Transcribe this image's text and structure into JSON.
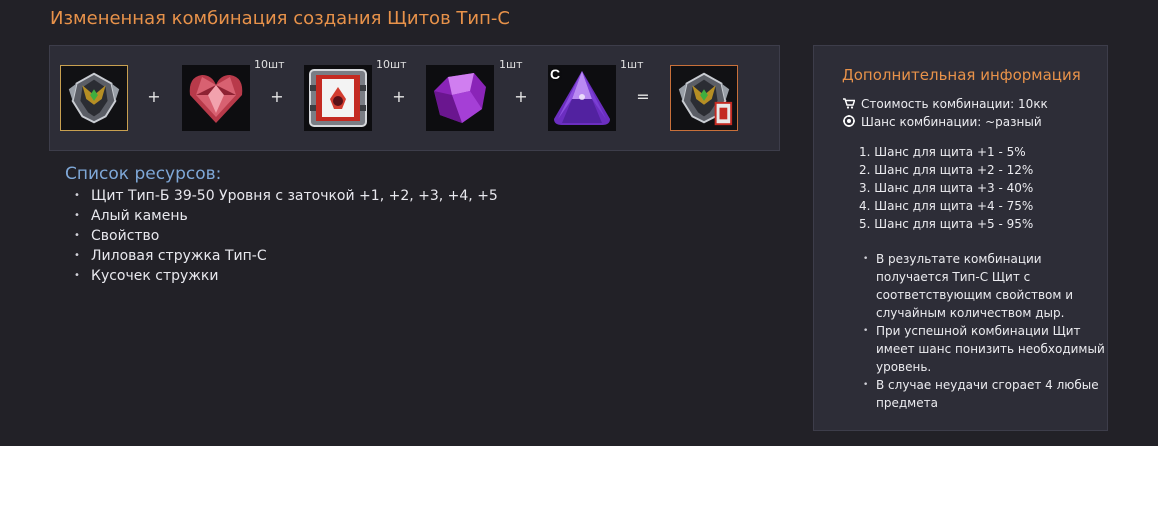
{
  "title": "Измененная комбинация создания Щитов Тип-С",
  "combination": {
    "items": [
      {
        "name": "Щит Тип-Б",
        "count": "",
        "label": ""
      },
      {
        "name": "Алый камень",
        "count": "10шт",
        "label": ""
      },
      {
        "name": "Свойство",
        "count": "10шт",
        "label": ""
      },
      {
        "name": "Лиловая стружка Тип-С",
        "count": "1шт",
        "label": ""
      },
      {
        "name": "Кусочек стружки",
        "count": "1шт",
        "label": "C"
      }
    ],
    "operators": [
      "+",
      "+",
      "+",
      "+",
      "="
    ],
    "result": {
      "name": "Щит Тип-С"
    }
  },
  "resources": {
    "heading": "Список ресурсов:",
    "items": [
      "Щит Тип-Б 39-50 Уровня с заточкой +1, +2, +3, +4, +5",
      "Алый камень",
      "Свойство",
      "Лиловая стружка Тип-С",
      "Кусочек стружки"
    ]
  },
  "info": {
    "heading": "Дополнительная информация",
    "cost": "Стоимость комбинации: 10кк",
    "chance": "Шанс комбинации: ~разный",
    "chances": [
      "1. Шанс для щита +1 - 5%",
      "2. Шанс для щита +2 - 12%",
      "3. Шанс для щита +3 - 40%",
      "4. Шанс для щита +4 - 75%",
      "5. Шанс для щита +5 - 95%"
    ],
    "notes": [
      "В результате комбинации получается Тип-С Щит с соответствующим свойством и случайным количеством дыр.",
      "При успешной комбинации Щит имеет шанс понизить необходимый уровень.",
      "В случае неудачи сгорает 4 любые предмета"
    ]
  },
  "colors": {
    "background": "#222127",
    "panel": "#2d2d37",
    "title": "#e8924a",
    "resources_heading": "#7fa8d8",
    "text": "#e8e8ee"
  },
  "icons": {
    "cost": "cart-icon",
    "chance": "chance-icon",
    "bullet": "bullet-dot"
  }
}
